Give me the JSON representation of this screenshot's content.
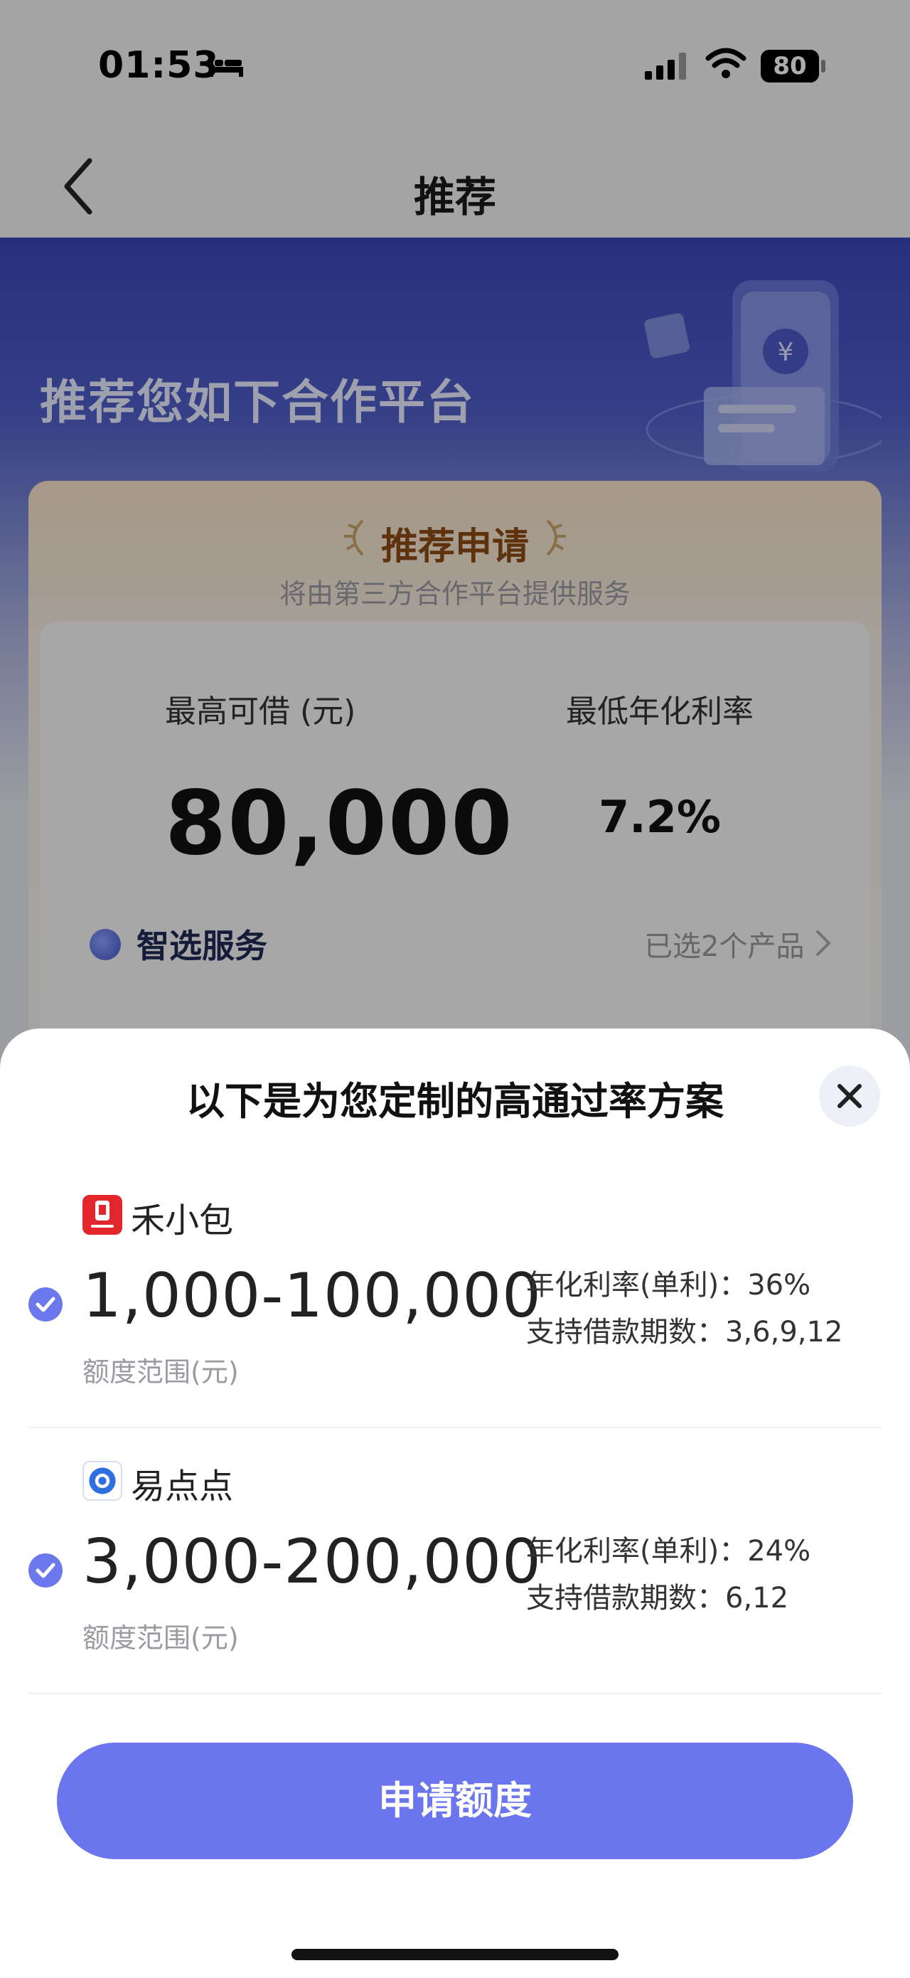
{
  "status_bar": {
    "time": "01:53",
    "battery": "80"
  },
  "nav": {
    "title": "推荐"
  },
  "hero": {
    "title": "推荐您如下合作平台"
  },
  "card": {
    "title": "推荐申请",
    "subtitle": "将由第三方合作平台提供服务",
    "max_label": "最高可借 (元)",
    "max_value": "80,000",
    "rate_label": "最低年化利率",
    "rate_value": "7.2%",
    "smart_label": "智选服务",
    "selected_count": "已选2个产品"
  },
  "sheet": {
    "title": "以下是为您定制的高通过率方案",
    "plans": [
      {
        "name": "禾小包",
        "range": "1,000-100,000",
        "range_label": "额度范围(元)",
        "rate": "年化利率(单利)：36%",
        "terms": "支持借款期数：3,6,9,12",
        "checked": true
      },
      {
        "name": "易点点",
        "range": "3,000-200,000",
        "range_label": "额度范围(元)",
        "rate": "年化利率(单利)：24%",
        "terms": "支持借款期数：6,12",
        "checked": true
      }
    ],
    "apply_label": "申请额度"
  },
  "colors": {
    "accent": "#6b76ee",
    "hero_blue": "#3a47b8",
    "card_title": "#8b4a12"
  }
}
